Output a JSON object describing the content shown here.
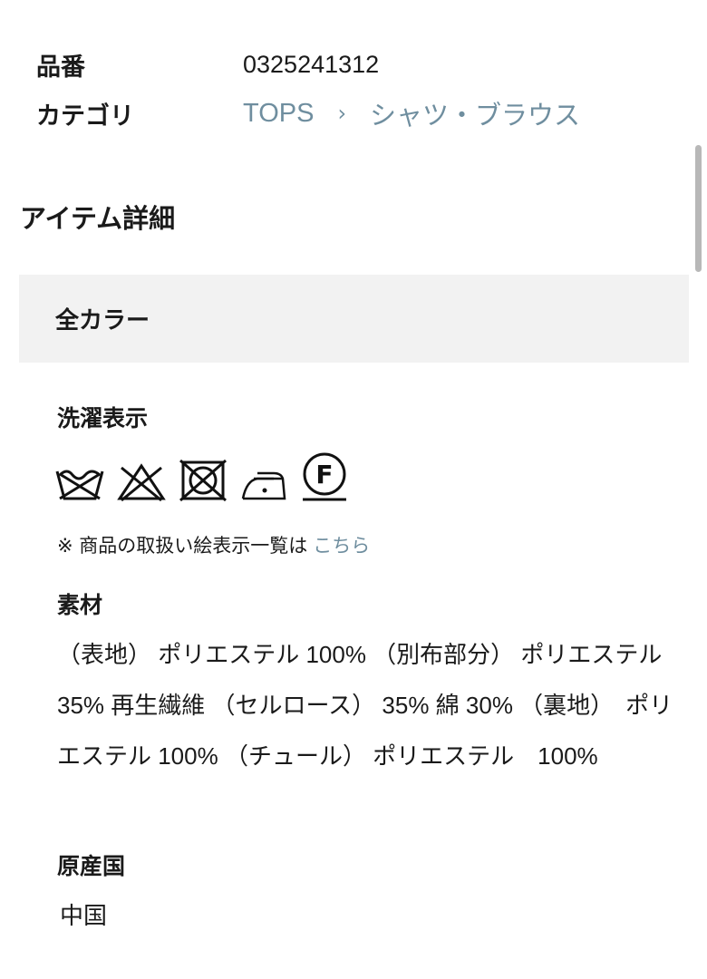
{
  "product": {
    "code_label": "品番",
    "code_value": "0325241312",
    "category_label": "カテゴリ",
    "breadcrumb": {
      "level1": "TOPS",
      "separator": "›",
      "level2": "シャツ・ブラウス"
    }
  },
  "item_details": {
    "title": "アイテム詳細",
    "all_colors": "全カラー",
    "care": {
      "title": "洗濯表示",
      "icons": [
        "hand-wash-icon",
        "no-bleach-icon",
        "no-tumble-dry-icon",
        "low-iron-icon",
        "dry-clean-f-icon"
      ],
      "note": "※ 商品の取扱い絵表示一覧は",
      "link": "こちら"
    },
    "material": {
      "title": "素材",
      "text": "（表地） ポリエステル 100% （別布部分） ポリエステル　35% 再生繊維 （セルロース） 35% 綿 30% （裏地）　ポリエステル 100% （チュール） ポリエステル　100%"
    },
    "origin": {
      "title": "原産国",
      "value": "中国"
    }
  },
  "colors": {
    "link": "#6f8e9f",
    "panel_bg": "#f2f2f2",
    "text": "#1a1a1a"
  }
}
